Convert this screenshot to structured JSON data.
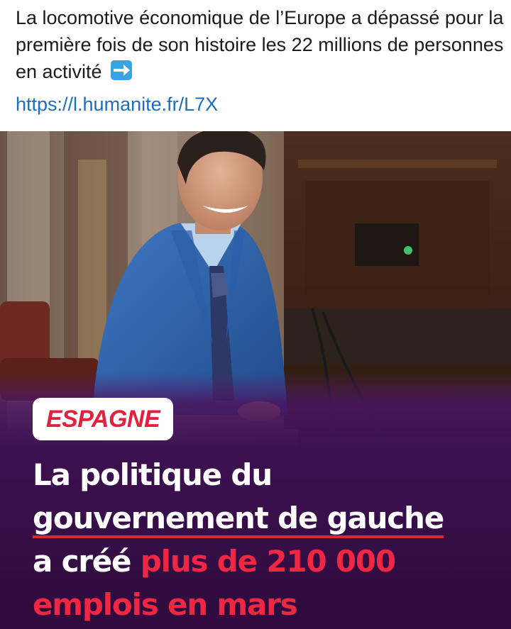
{
  "post": {
    "text": "La locomotive économique de l’Europe a dépassé pour la première fois de son histoire les 22 millions de personnes en activité",
    "emoji_icon": "right-arrow-emoji",
    "link": "https://l.humanite.fr/L7X"
  },
  "card": {
    "tag": "ESPAGNE",
    "headline": {
      "line1": "La politique du",
      "line2": "gouvernement de gauche",
      "line3_white": "a créé ",
      "line3_red": "plus de 210 000",
      "line4_red": "emplois en mars"
    },
    "colors": {
      "accent_red": "#e3213d",
      "purple_band": "#3d1150",
      "link_blue": "#1a6fc2"
    }
  }
}
